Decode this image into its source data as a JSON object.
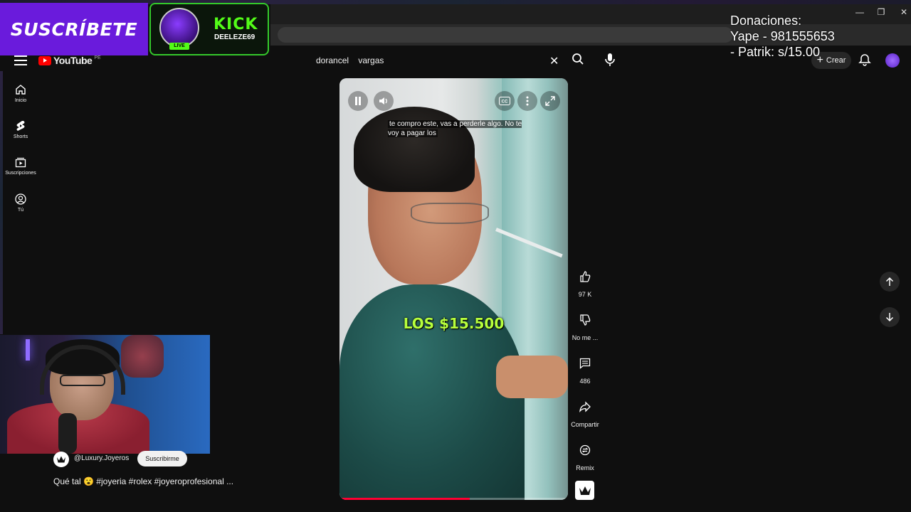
{
  "overlay": {
    "subscribe_banner": "SUSCRÍBETE",
    "kick_logo": "KICK",
    "kick_user": "DEELEZE69",
    "live_badge": "LIVE",
    "donations": [
      "Donaciones:",
      "Yape - 981555653",
      "- Patrik: s/15.00"
    ]
  },
  "header": {
    "logo_text": "YouTube",
    "logo_country": "PE",
    "search_value": "dorancel    vargas",
    "create_label": "Crear"
  },
  "sidebar": {
    "items": [
      {
        "label": "Inicio",
        "icon": "home-icon"
      },
      {
        "label": "Shorts",
        "icon": "shorts-icon"
      },
      {
        "label": "Suscripciones",
        "icon": "subscriptions-icon"
      },
      {
        "label": "Tú",
        "icon": "you-icon"
      }
    ]
  },
  "video": {
    "caption": "te compro este, vas a perderle algo. No te voy a pagar los",
    "overlay_text": "LOS $15.500",
    "progress": 0.57
  },
  "actions": {
    "likes": "97 K",
    "dislike_label": "No me ...",
    "comments": "486",
    "share_label": "Compartir",
    "remix_label": "Remix"
  },
  "channel": {
    "name": "@Luxury.Joyeros",
    "subscribe_label": "Suscribirme",
    "title": "Qué tal 😮 #joyeria #rolex #joyeroprofesional ..."
  },
  "colors": {
    "accent": "#ff0033",
    "banner": "#6a1bdc",
    "kick_green": "#53fc18",
    "overlay_text": "#b7ff3c"
  }
}
